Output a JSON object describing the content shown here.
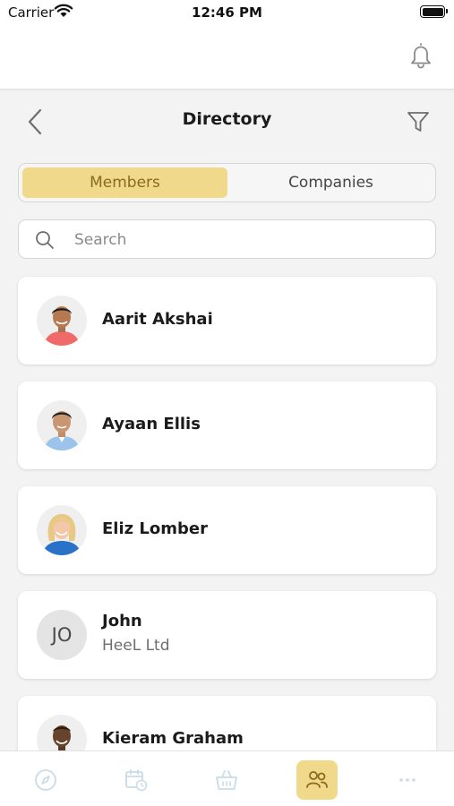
{
  "status_bar": {
    "carrier": "Carrier",
    "time": "12:46 PM"
  },
  "header": {
    "title": "Directory",
    "icons": [
      "bell-icon",
      "back-arrow-icon",
      "filter-icon"
    ]
  },
  "segments": {
    "members": "Members",
    "companies": "Companies",
    "selected": "Members"
  },
  "search": {
    "placeholder": "Search"
  },
  "members": [
    {
      "name": "Aarit Akshai",
      "avatar": "photo"
    },
    {
      "name": "Ayaan Ellis",
      "avatar": "photo"
    },
    {
      "name": "Eliz Lomber",
      "avatar": "photo"
    },
    {
      "name": "John",
      "company": "HeeL Ltd",
      "initials": "JO"
    },
    {
      "name": "Kieram Graham",
      "avatar": "photo"
    }
  ],
  "tab_bar": {
    "tabs": [
      "compass-icon",
      "calendar-clock-icon",
      "basket-icon",
      "people-icon",
      "more-icon"
    ],
    "active": "people-icon"
  },
  "colors": {
    "accent": "#f0d98a",
    "accent_text": "#8a6a1c",
    "inactive_icon": "#c9dbe6",
    "background": "#f3f3f3"
  }
}
